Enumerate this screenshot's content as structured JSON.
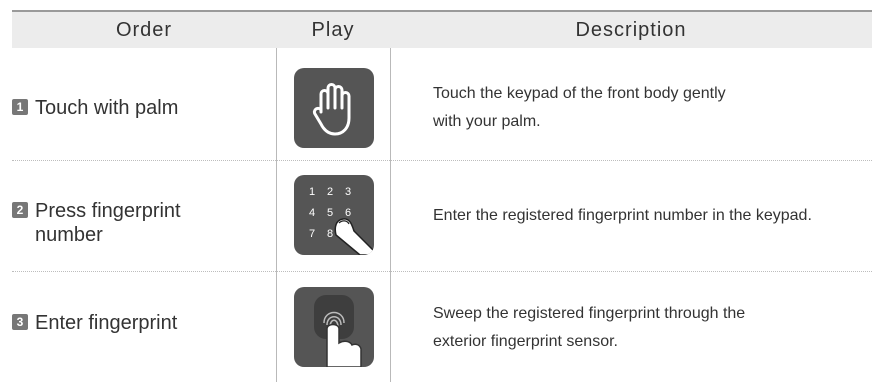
{
  "header": {
    "order": "Order",
    "play": "Play",
    "description": "Description"
  },
  "rows": [
    {
      "num": "1",
      "order": "Touch with palm",
      "play_icon": "palm-icon",
      "desc": [
        "Touch the keypad of the front body gently",
        "with your palm."
      ]
    },
    {
      "num": "2",
      "order": "Press fingerprint\nnumber",
      "play_icon": "keypad-press-icon",
      "keys": [
        "1",
        "2",
        "3",
        "4",
        "5",
        "6",
        "7",
        "8"
      ],
      "desc": [
        "Enter the registered fingerprint number in the keypad."
      ]
    },
    {
      "num": "3",
      "order": "Enter fingerprint",
      "play_icon": "fingerprint-sensor-icon",
      "desc": [
        "Sweep the registered fingerprint through the",
        "exterior fingerprint sensor."
      ]
    }
  ]
}
